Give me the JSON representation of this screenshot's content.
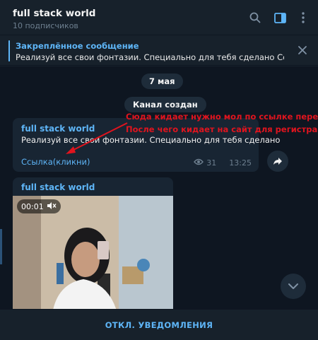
{
  "header": {
    "title": "full stack world",
    "subtitle": "10 подписчиков",
    "icons": [
      "search-icon",
      "sidebar-toggle-icon",
      "more-vertical-icon"
    ]
  },
  "pinned": {
    "title": "Закреплённое сообщение",
    "text": "Реализуй все свои фонтазии. Специально для тебя сделано  Ссылк..."
  },
  "chat": {
    "date_label": "7 мая",
    "service_label": "Канал создан",
    "messages": [
      {
        "author": "full stack world",
        "text": "Реализуй все свои фонтазии. Специально для тебя сделано",
        "link_label": "Ссылка(кликни)",
        "views": "31",
        "time": "13:25"
      },
      {
        "author": "full stack world",
        "video_duration": "00:01"
      }
    ],
    "annotation": {
      "line1": "Сюда кидает нужно мол по ссылке перейти",
      "line2": "После чего кидает на сайт для регистрации",
      "color": "#e0141e"
    }
  },
  "bottom": {
    "label": "ОТКЛ. УВЕДОМЛЕНИЯ"
  },
  "colors": {
    "accent": "#5eb5f7",
    "background": "#0e1621",
    "panel": "#17212b",
    "bubble": "#182533"
  }
}
